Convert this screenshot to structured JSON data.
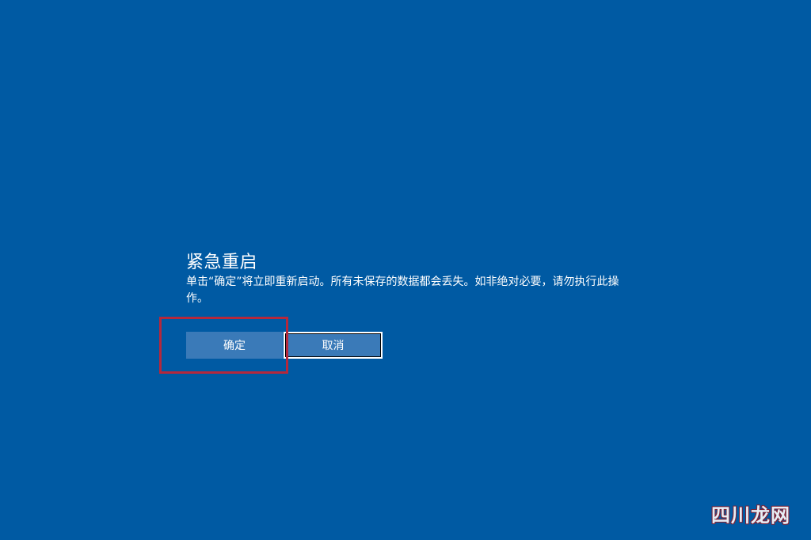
{
  "dialog": {
    "title": "紧急重启",
    "message": "单击“确定”将立即重新启动。所有未保存的数据都会丢失。如非绝对必要，请勿执行此操作。",
    "confirm_label": "确定",
    "cancel_label": "取消"
  },
  "watermark": {
    "text": "四川龙网"
  },
  "colors": {
    "background": "#005aa3",
    "button": "#3a7ab8",
    "highlight": "#b5283c"
  }
}
